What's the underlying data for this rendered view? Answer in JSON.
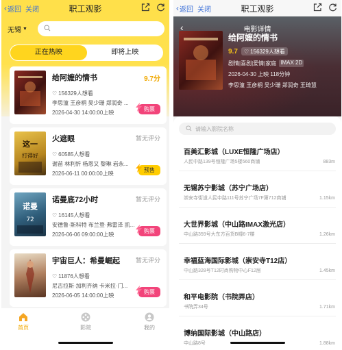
{
  "nav": {
    "back": "返回",
    "close": "关闭",
    "title": "职工观影"
  },
  "list_page": {
    "city": "无锡",
    "tabs": [
      "正在热映",
      "即将上映"
    ],
    "movies": [
      {
        "title": "给阿嬷的情书",
        "score": "9.7分",
        "want": "156329人想看",
        "cast": "李思潼 王彦桐 吴少珊 郑润奇 ...",
        "date": "2026-04-30 14:00:00上映",
        "button": "购票",
        "button_type": "buy",
        "poster_color": "#6b1f1f"
      },
      {
        "title": "火遮眼",
        "score": "暂无评分",
        "want": "60585人想看",
        "cast": "谢苗 林利忻 杨恩又 黎琳 岩永...",
        "date": "2026-06-11 00:00:00上映",
        "button": "预售",
        "button_type": "pre",
        "poster_color": "#c89a26"
      },
      {
        "title": "诺曼底72小时",
        "score": "暂无评分",
        "want": "16145人想看",
        "cast": "安德鲁·斯科特 布兰登·弗雷泽 凯...",
        "date": "2026-06-06 09:00:00上映",
        "button": "购票",
        "button_type": "buy",
        "poster_color": "#3d6f8e"
      },
      {
        "title": "宇宙巨人：希曼崛起",
        "score": "暂无评分",
        "want": "11876人想看",
        "cast": "尼古拉斯·加利齐纳 卡米拉·门...",
        "date": "2026-06-05 14:00:00上映",
        "button": "购票",
        "button_type": "buy",
        "poster_color": "#8a5a3a"
      }
    ],
    "tabbar": [
      {
        "label": "首页",
        "icon": "home-icon",
        "active": true
      },
      {
        "label": "影院",
        "icon": "film-reel-icon",
        "active": false
      },
      {
        "label": "我的",
        "icon": "user-icon",
        "active": false
      }
    ]
  },
  "detail_page": {
    "header_title": "电影详情",
    "movie": {
      "title": "给阿嬷的情书",
      "score": "9.7",
      "want": "156329人想看",
      "genres": "剧情|喜剧|爱情|家庭",
      "format": "IMAX 2D",
      "info": "2026-04-30 上映 118分钟",
      "cast": "李思潼 王彦桐 吴少珊 郑润奇 王琦慧"
    },
    "search_placeholder": "请输入影院名称",
    "cinemas": [
      {
        "name": "百美汇影城（LUXE恒隆广场店）",
        "address": "人民中路139号恒隆广场5楼560商铺",
        "distance": "883m"
      },
      {
        "name": "无锡苏宁影城（苏宁广场店）",
        "address": "崇安寺街道人民中路111号苏宁广场7F第712商铺",
        "distance": "1.15km"
      },
      {
        "name": "大世界影城（中山路IMAX激光店）",
        "address": "中山路359号大东方百货B幢6-7楼",
        "distance": "1.26km"
      },
      {
        "name": "幸福蓝海国际影城（崇安寺T12店）",
        "address": "中山路328号T12时尚购物中心F12层",
        "distance": "1.45km"
      },
      {
        "name": "和平电影院（书院弄店）",
        "address": "书院弄34号",
        "distance": "1.71km"
      },
      {
        "name": "博纳国际影城（中山路店）",
        "address": "中山路8号",
        "distance": "1.88km"
      }
    ]
  },
  "colors": {
    "yellow": "#ffe04a",
    "accent": "#f0a800",
    "buy": "#f2447a",
    "link": "#3a6fd8"
  }
}
